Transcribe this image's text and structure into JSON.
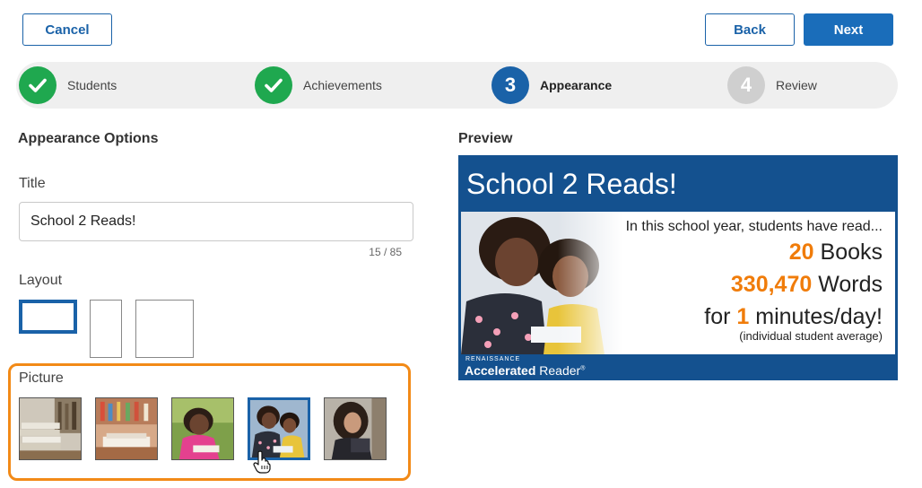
{
  "header": {
    "cancel_label": "Cancel",
    "back_label": "Back",
    "next_label": "Next"
  },
  "steps": [
    {
      "label": "Students",
      "status": "done",
      "marker": "✓"
    },
    {
      "label": "Achievements",
      "status": "done",
      "marker": "✓"
    },
    {
      "label": "Appearance",
      "status": "current",
      "marker": "3"
    },
    {
      "label": "Review",
      "status": "todo",
      "marker": "4"
    }
  ],
  "options": {
    "heading": "Appearance Options",
    "title_label": "Title",
    "title_value": "School 2 Reads!",
    "title_counter": "15 / 85",
    "layout_label": "Layout",
    "picture_label": "Picture",
    "selected_layout_index": 0,
    "selected_picture_index": 3,
    "pictures": [
      "books-stack-photo",
      "library-books-photo",
      "girl-reading-photo",
      "two-girls-reading-photo",
      "woman-tablet-photo"
    ]
  },
  "preview": {
    "heading": "Preview",
    "title": "School 2 Reads!",
    "intro": "In this school year, students have read...",
    "books_value": "20",
    "books_unit": "Books",
    "words_value": "330,470",
    "words_unit": "Words",
    "per_prefix": "for",
    "per_value": "1",
    "per_unit": "minutes/day!",
    "note": "(individual student average)",
    "brand_small": "RENAISSANCE",
    "brand_bold": "Accelerated",
    "brand_light": "Reader",
    "brand_mark": "®"
  },
  "colors": {
    "primary": "#1a6dba",
    "success": "#1fa84f",
    "highlight": "#f28a17",
    "stat_orange": "#f07c0a",
    "preview_bg": "#14518f"
  }
}
